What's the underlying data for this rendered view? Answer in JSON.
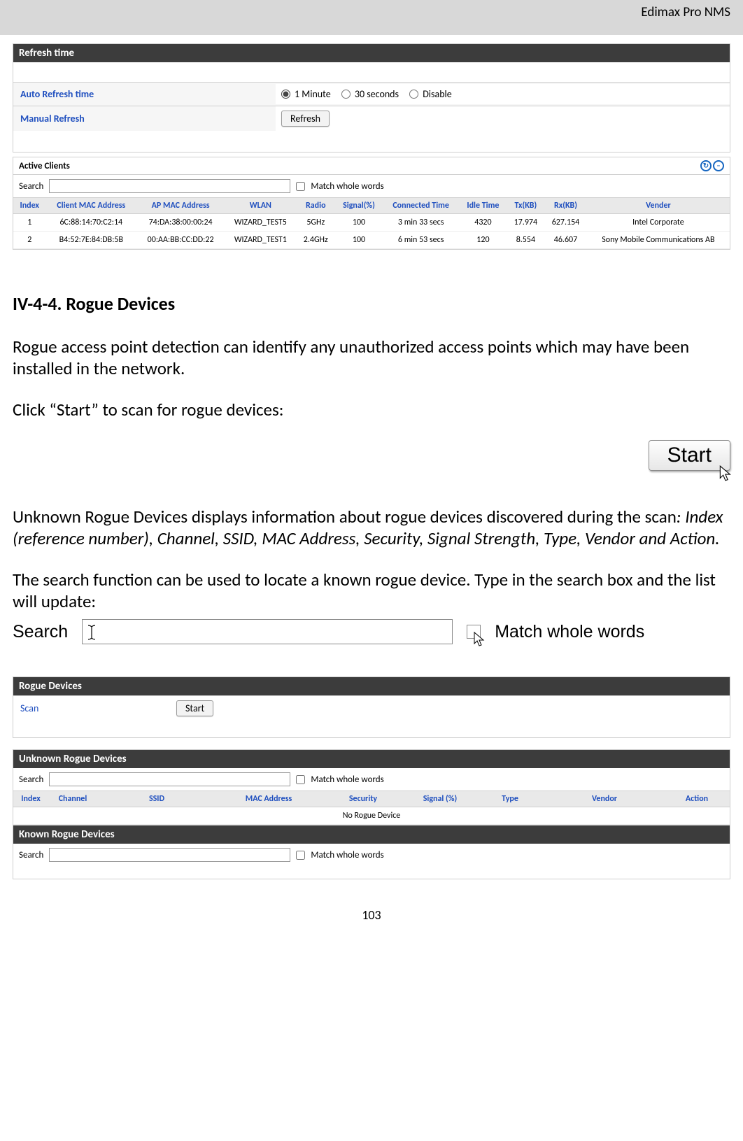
{
  "header": {
    "product": "Edimax Pro NMS"
  },
  "refresh": {
    "title": "Refresh time",
    "auto_label": "Auto Refresh time",
    "manual_label": "Manual Refresh",
    "options": {
      "one_min": "1 Minute",
      "thirty_sec": "30 seconds",
      "disable": "Disable"
    },
    "refresh_btn": "Refresh"
  },
  "active_clients": {
    "title": "Active Clients",
    "search_label": "Search",
    "match_label": "Match whole words",
    "headers": {
      "index": "Index",
      "client_mac": "Client MAC Address",
      "ap_mac": "AP MAC Address",
      "wlan": "WLAN",
      "radio": "Radio",
      "signal": "Signal(%)",
      "connected": "Connected Time",
      "idle": "Idle Time",
      "tx": "Tx(KB)",
      "rx": "Rx(KB)",
      "vendor": "Vender"
    },
    "rows": [
      {
        "index": "1",
        "client_mac": "6C:88:14:70:C2:14",
        "ap_mac": "74:DA:38:00:00:24",
        "wlan": "WIZARD_TEST5",
        "radio": "5GHz",
        "signal": "100",
        "connected": "3 min 33 secs",
        "idle": "4320",
        "tx": "17.974",
        "rx": "627.154",
        "vendor": "Intel Corporate"
      },
      {
        "index": "2",
        "client_mac": "B4:52:7E:84:DB:5B",
        "ap_mac": "00:AA:BB:CC:DD:22",
        "wlan": "WIZARD_TEST1",
        "radio": "2.4GHz",
        "signal": "100",
        "connected": "6 min 53 secs",
        "idle": "120",
        "tx": "8.554",
        "rx": "46.607",
        "vendor": "Sony Mobile Communications AB"
      }
    ]
  },
  "doc": {
    "section_title": "IV-4-4. Rogue Devices",
    "p1": "Rogue access point detection can identify any unauthorized access points which may have been installed in the network.",
    "p2": "Click “Start” to scan for rogue devices:",
    "start_btn": "Start",
    "p3a": "Unknown Rogue Devices displays information about rogue devices discovered during the scan",
    "p3b": ": Index (reference number), Channel, SSID, MAC Address, Security, Signal Strength, Type, Vendor and Action.",
    "p4": "The search function can be used to locate a known rogue device. Type in the search box and the list will update:",
    "search_illus_label": "Search",
    "search_illus_match": "Match whole words"
  },
  "rogue": {
    "panel_title": "Rogue Devices",
    "scan_label": "Scan",
    "start_btn": "Start",
    "unknown_title": "Unknown Rogue Devices",
    "known_title": "Known Rogue Devices",
    "search_label": "Search",
    "match_label": "Match whole words",
    "headers": {
      "index": "Index",
      "channel": "Channel",
      "ssid": "SSID",
      "mac": "MAC Address",
      "security": "Security",
      "signal": "Signal (%)",
      "type": "Type",
      "vendor": "Vendor",
      "action": "Action"
    },
    "no_device": "No Rogue Device"
  },
  "page_number": "103"
}
